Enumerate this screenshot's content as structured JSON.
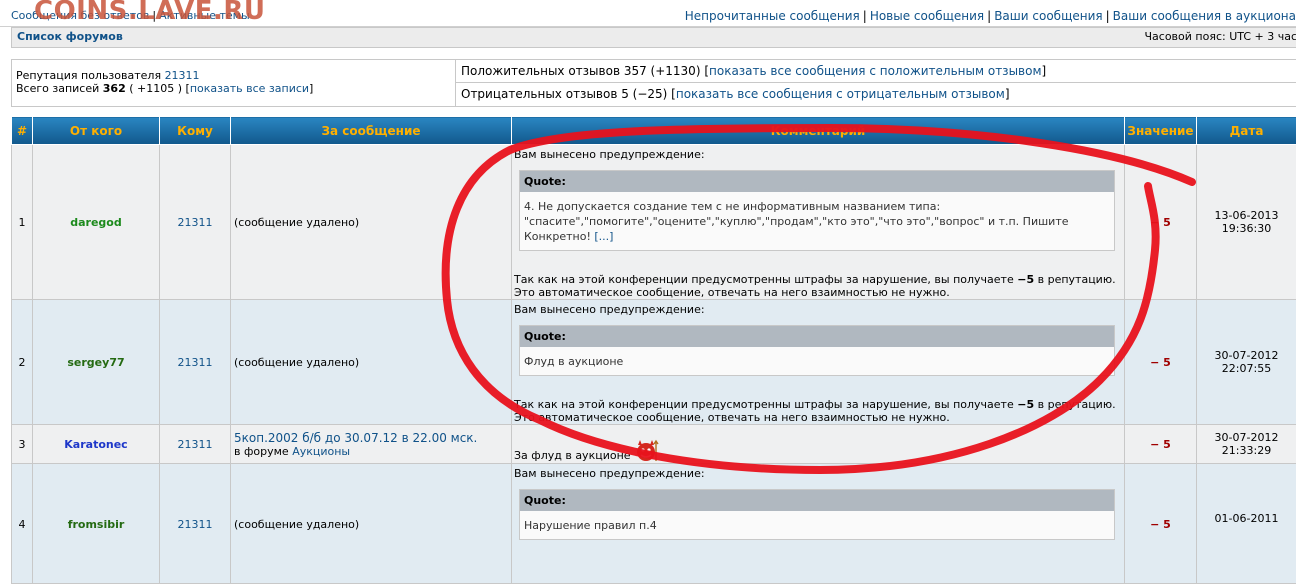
{
  "watermark": "COINS.LAVE.RU",
  "topbar": {
    "left_links": [
      "Сообщения без ответов",
      "Активные темы"
    ],
    "right_links": [
      "Непрочитанные сообщения",
      "Новые сообщения",
      "Ваши сообщения",
      "Ваши сообщения в аукциона"
    ]
  },
  "navbar": {
    "forums": "Список форумов",
    "timezone": "Часовой пояс: UTC + 3 час"
  },
  "reputation": {
    "user_label": "Репутация пользователя",
    "user_id": "21311",
    "total_label": "Всего записей",
    "total_count": "362",
    "total_delta": "( +1105 )",
    "show_all": "показать все записи",
    "positive_label": "Положительных отзывов 357 (+1130)",
    "positive_link": "показать все сообщения с положительным отзывом",
    "negative_label": "Отрицательных отзывов 5 (−25)",
    "negative_link": "показать все сообщения с отрицательным отзывом"
  },
  "table": {
    "headers": [
      "#",
      "От кого",
      "Кому",
      "За сообщение",
      "Комментарий",
      "Значение",
      "Дата"
    ],
    "rows": [
      {
        "num": "1",
        "from": "daregod",
        "to": "21311",
        "msg": "(сообщение удалено)",
        "warn": "Вам вынесено предупреждение:",
        "quote_title": "Quote:",
        "quote_line1": "4. Не допускается создание тем с не информативным названием типа:",
        "quote_line2": "\"спасите\",\"помогите\",\"оцените\",\"куплю\",\"продам\",\"кто это\",\"что это\",\"вопрос\" и т.п. Пишите Конкретно!",
        "quote_more": "[...]",
        "penalty_pre": "Так как на этой конференции предусмотренны штрафы за нарушение, вы получаете",
        "penalty_val": "−5",
        "penalty_post": "в репутацию.",
        "auto_note": "Это автоматическое сообщение, отвечать на него взаимностью не нужно.",
        "value": "− 5",
        "date1": "13-06-2013",
        "date2": "19:36:30"
      },
      {
        "num": "2",
        "from": "sergey77",
        "to": "21311",
        "msg": "(сообщение удалено)",
        "warn": "Вам вынесено предупреждение:",
        "quote_title": "Quote:",
        "quote_line1": "Флуд в аукционе",
        "penalty_pre": "Так как на этой конференции предусмотренны штрафы за нарушение, вы получаете",
        "penalty_val": "−5",
        "penalty_post": "в репутацию.",
        "auto_note": "Это автоматическое сообщение, отвечать на него взаимностью не нужно.",
        "value": "− 5",
        "date1": "30-07-2012",
        "date2": "22:07:55"
      },
      {
        "num": "3",
        "from": "Karatonec",
        "to": "21311",
        "msg_link": "5коп.2002 б/б до 30.07.12 в 22.00 мск.",
        "msg_in": "в форуме",
        "msg_forum": "Аукционы",
        "comment": "За флуд в аукционе",
        "value": "− 5",
        "date1": "30-07-2012",
        "date2": "21:33:29"
      },
      {
        "num": "4",
        "from": "fromsibir",
        "to": "21311",
        "msg": "(сообщение удалено)",
        "warn": "Вам вынесено предупреждение:",
        "quote_title": "Quote:",
        "quote_line1": "Нарушение правил п.4",
        "value": "− 5",
        "date1": "01-06-2011"
      }
    ]
  },
  "colors": {
    "header_bg": "#1a6fa5",
    "header_text": "#ffb000",
    "link": "#105289",
    "penalty": "#a00000",
    "annotation": "#e8121c"
  }
}
